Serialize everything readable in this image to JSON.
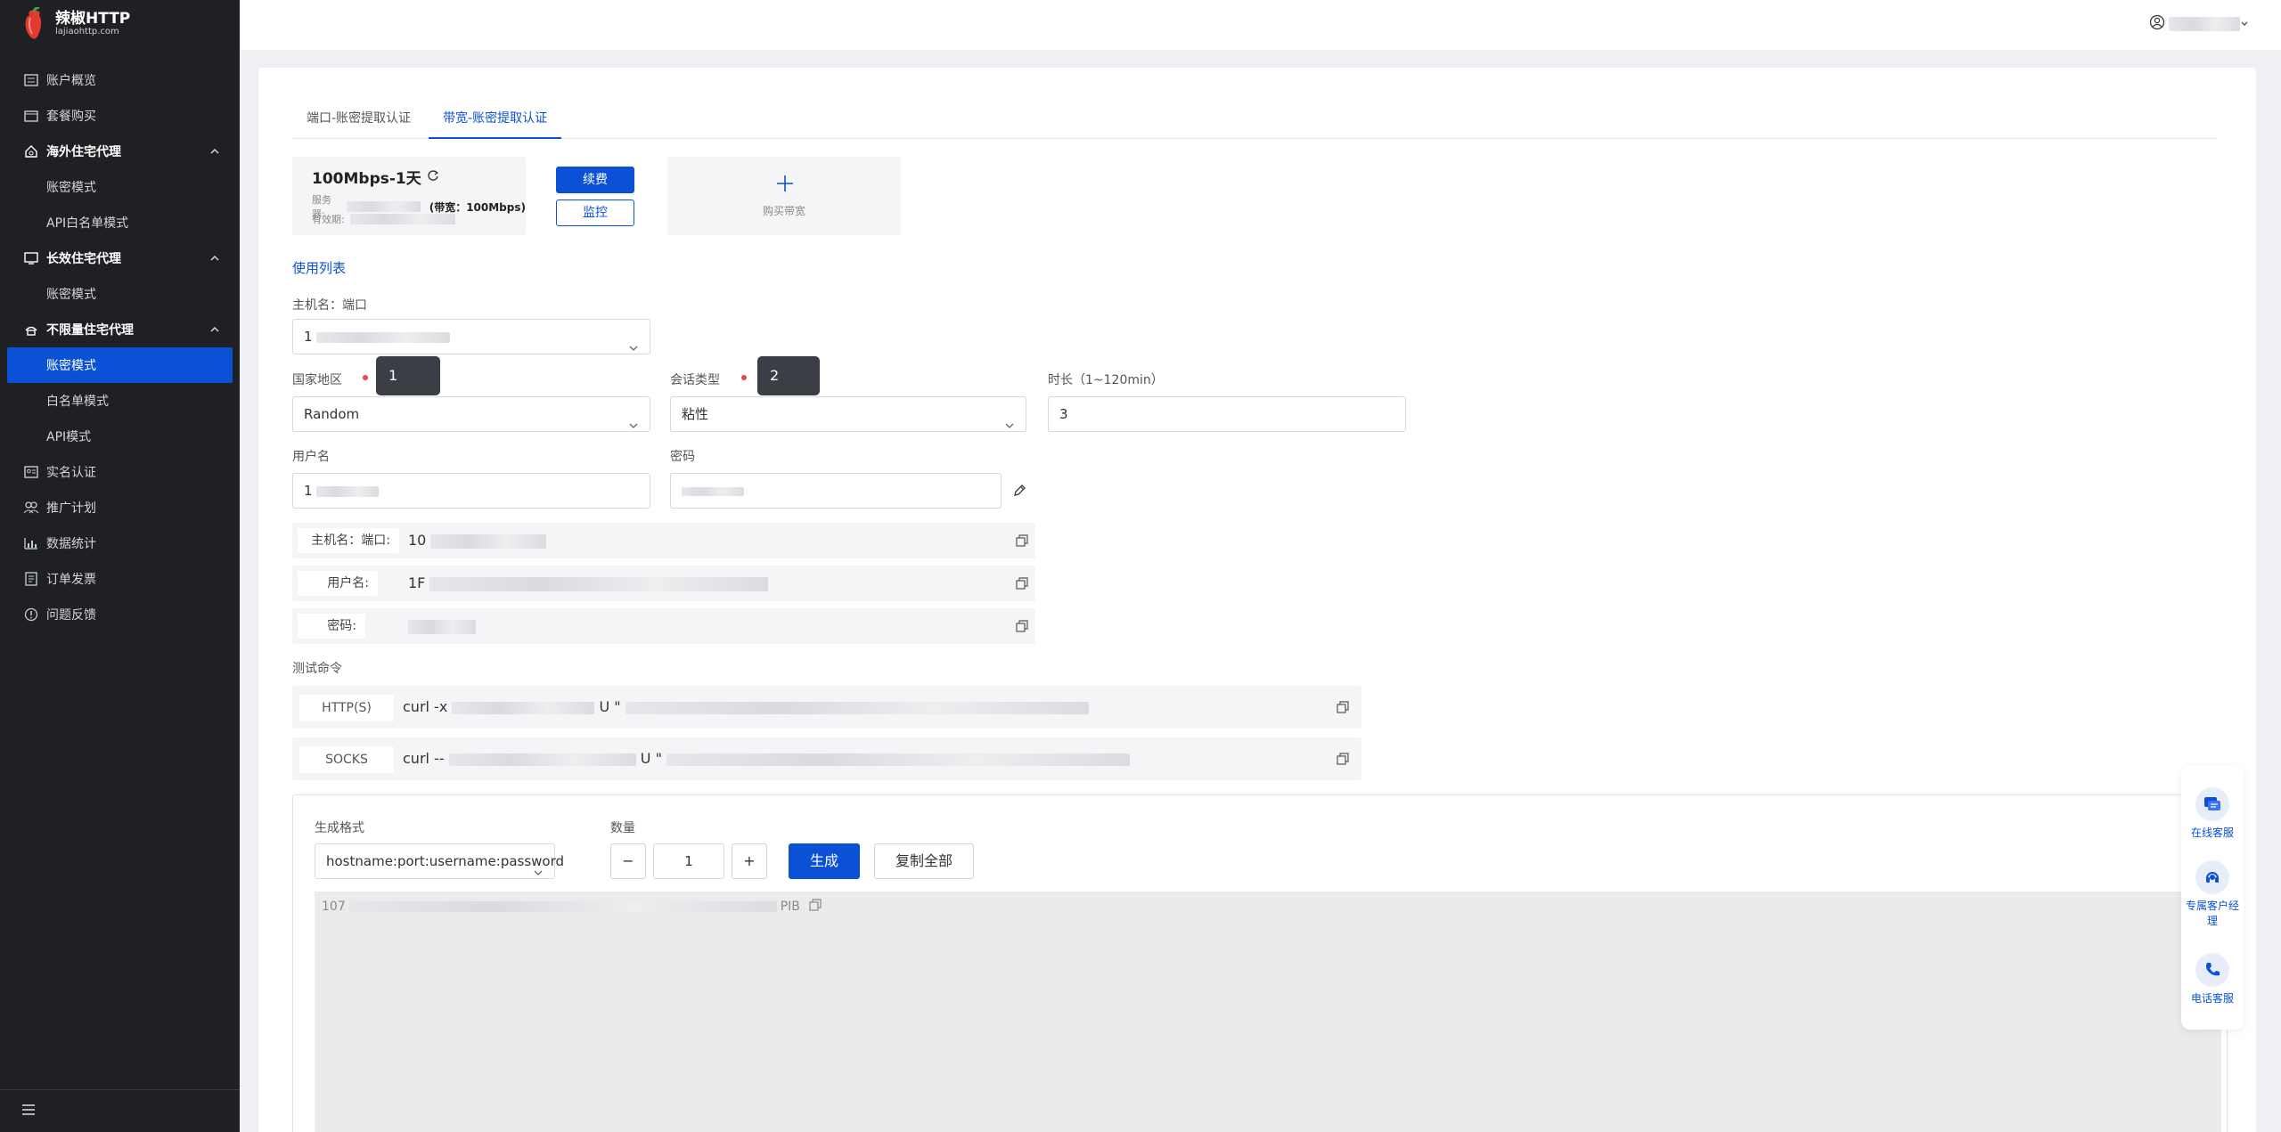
{
  "brand": {
    "title": "辣椒HTTP",
    "subtitle": "lajiaohttp.com"
  },
  "sidebar": {
    "items": [
      {
        "label": "账户概览",
        "type": "item",
        "icon": "dashboard-icon"
      },
      {
        "label": "套餐购买",
        "type": "item",
        "icon": "cart-icon"
      },
      {
        "label": "海外住宅代理",
        "type": "group",
        "icon": "home-drop-icon"
      },
      {
        "label": "账密模式",
        "type": "sub"
      },
      {
        "label": "API白名单模式",
        "type": "sub"
      },
      {
        "label": "长效住宅代理",
        "type": "group",
        "icon": "monitor-icon"
      },
      {
        "label": "账密模式",
        "type": "sub"
      },
      {
        "label": "不限量住宅代理",
        "type": "group",
        "icon": "house-signal-icon"
      },
      {
        "label": "账密模式",
        "type": "sub-active"
      },
      {
        "label": "白名单模式",
        "type": "sub"
      },
      {
        "label": "API模式",
        "type": "sub"
      },
      {
        "label": "实名认证",
        "type": "item",
        "icon": "id-card-icon"
      },
      {
        "label": "推广计划",
        "type": "item",
        "icon": "people-icon"
      },
      {
        "label": "数据统计",
        "type": "item",
        "icon": "chart-icon"
      },
      {
        "label": "订单发票",
        "type": "item",
        "icon": "receipt-icon"
      },
      {
        "label": "问题反馈",
        "type": "item",
        "icon": "alert-icon"
      }
    ]
  },
  "tabs": [
    "端口-账密提取认证",
    "带宽-账密提取认证"
  ],
  "plan": {
    "title": "100Mbps-1天",
    "server_label": "服务器:",
    "bandwidth": "(带宽：100Mbps)",
    "expiry_label": "有效期:",
    "renew": "续费",
    "monitor": "监控",
    "buy": "购买带宽"
  },
  "usage_list": "使用列表",
  "host_label": "主机名：端口",
  "host_value": "1",
  "country_label": "国家地区",
  "country_value": "Random",
  "session_label": "会话类型",
  "session_value": "粘性",
  "duration_label": "时长（1~120min）",
  "duration_value": "3",
  "username_label": "用户名",
  "username_value": "1",
  "password_label": "密码",
  "tips": [
    "1",
    "2"
  ],
  "info_rows": [
    {
      "key": "主机名：端口:",
      "value": "10"
    },
    {
      "key": "用户名:",
      "value": "1F"
    },
    {
      "key": "密码:",
      "value": ""
    }
  ],
  "test_cmd_label": "测试命令",
  "commands": [
    {
      "key": "HTTP(S)",
      "prefix": "curl -x",
      "mid": "U \""
    },
    {
      "key": "SOCKS",
      "prefix": "curl --",
      "mid": "U \""
    }
  ],
  "generator": {
    "format_label": "生成格式",
    "format_value": "hostname:port:username:password",
    "qty_label": "数量",
    "qty_value": "1",
    "minus": "−",
    "plus": "+",
    "generate": "生成",
    "copy_all": "复制全部",
    "result_prefix": "107",
    "result_suffix": "PIB"
  },
  "float": [
    {
      "label": "在线客服"
    },
    {
      "label": "专属客户经理"
    },
    {
      "label": "电话客服"
    }
  ]
}
